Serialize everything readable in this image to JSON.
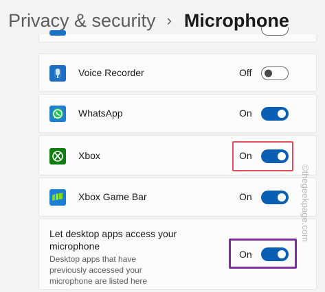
{
  "breadcrumb": {
    "parent": "Privacy & security",
    "separator": "›",
    "current": "Microphone"
  },
  "apps": [
    {
      "name": "Voice Recorder",
      "state": "Off",
      "enabled": false,
      "icon": "voice-recorder-icon"
    },
    {
      "name": "WhatsApp",
      "state": "On",
      "enabled": true,
      "icon": "whatsapp-icon"
    },
    {
      "name": "Xbox",
      "state": "On",
      "enabled": true,
      "icon": "xbox-icon"
    },
    {
      "name": "Xbox Game Bar",
      "state": "On",
      "enabled": true,
      "icon": "xbox-game-bar-icon"
    }
  ],
  "desktop_apps": {
    "title": "Let desktop apps access your microphone",
    "description": "Desktop apps that have previously accessed your microphone are listed here",
    "state": "On",
    "enabled": true
  },
  "watermark": "©thegeekpage.com",
  "colors": {
    "accent": "#0a5fb4",
    "highlight_red": "#e64d5b",
    "highlight_purple": "#7b2fa3"
  }
}
